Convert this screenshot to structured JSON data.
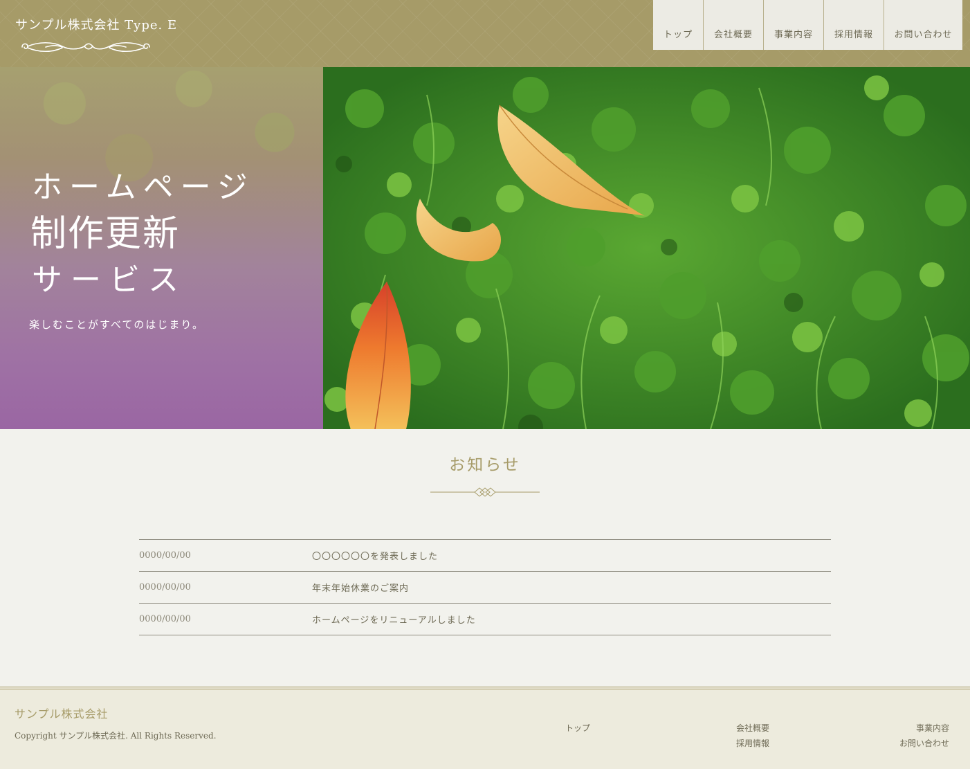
{
  "header": {
    "logo_text": "サンプル株式会社 Type. E",
    "nav": [
      {
        "label": "トップ"
      },
      {
        "label": "会社概要"
      },
      {
        "label": "事業内容"
      },
      {
        "label": "採用情報"
      },
      {
        "label": "お問い合わせ"
      }
    ]
  },
  "hero": {
    "title_line1": "ホームページ",
    "title_line2": "制作更新",
    "title_line3": "サービス",
    "subtitle": "楽しむことがすべてのはじまり。"
  },
  "news": {
    "title": "お知らせ",
    "items": [
      {
        "date": "0000/00/00",
        "text": "〇〇〇〇〇〇を発表しました"
      },
      {
        "date": "0000/00/00",
        "text": "年末年始休業のご案内"
      },
      {
        "date": "0000/00/00",
        "text": "ホームページをリニューアルしました"
      }
    ]
  },
  "footer": {
    "company": "サンプル株式会社",
    "copyright": "Copyright サンプル株式会社. All Rights Reserved.",
    "links": {
      "top": "トップ",
      "about": "会社概要",
      "business": "事業内容",
      "recruit": "採用情報",
      "contact": "お問い合わせ"
    }
  },
  "colors": {
    "brand": "#a69b68",
    "hero_gradient_bottom": "#9a66a3",
    "background": "#f2f2ed",
    "footer_bg": "#edebdd"
  }
}
